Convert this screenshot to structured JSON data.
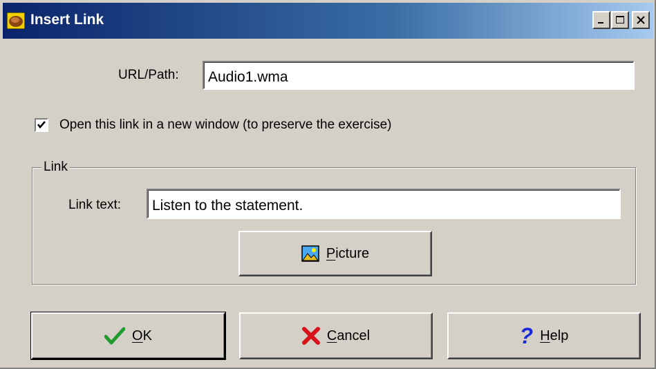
{
  "window": {
    "title": "Insert Link",
    "icon": "app-nut-icon",
    "controls": [
      "minimize-icon",
      "maximize-icon",
      "close-icon"
    ]
  },
  "url": {
    "label": "URL/Path:",
    "value": "Audio1.wma"
  },
  "new_window": {
    "label": "Open this link in a new window (to preserve the exercise)",
    "checked": true
  },
  "link_group": {
    "legend": "Link",
    "text_label": "Link text:",
    "text_value": "Listen to the statement.",
    "picture_button": {
      "mnemonic": "P",
      "rest": "icture",
      "icon": "picture-icon"
    }
  },
  "buttons": {
    "ok": {
      "mnemonic": "O",
      "rest": "K",
      "icon": "checkmark-icon"
    },
    "cancel": {
      "mnemonic": "C",
      "rest": "ancel",
      "icon": "cross-icon"
    },
    "help": {
      "mnemonic": "H",
      "rest": "elp",
      "icon": "question-icon"
    }
  },
  "colors": {
    "title_start": "#0a246a",
    "title_end": "#a6caf0",
    "face": "#d4d0c8",
    "ok_green": "#1f9a2f",
    "cancel_red": "#d8141a",
    "help_blue": "#1a2ad8"
  }
}
